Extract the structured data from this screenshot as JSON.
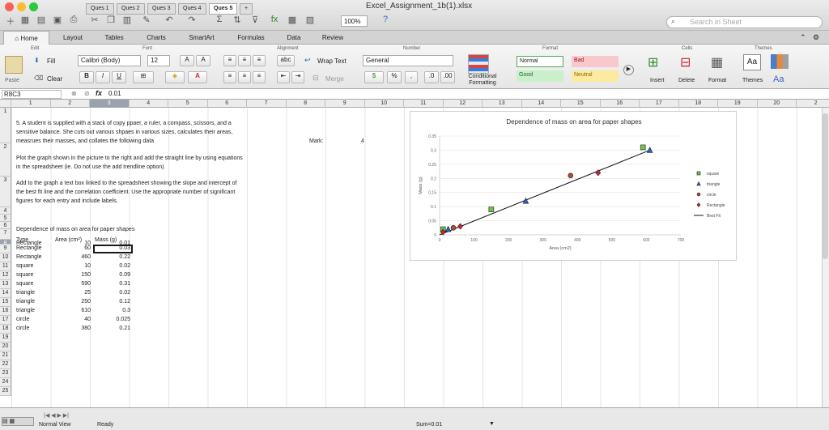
{
  "window": {
    "title": "Excel_Assignment_1b(1).xlsx",
    "zoom": "100%"
  },
  "search": {
    "placeholder": "Search in Sheet"
  },
  "ribbon_tabs": [
    "Home",
    "Layout",
    "Tables",
    "Charts",
    "SmartArt",
    "Formulas",
    "Data",
    "Review"
  ],
  "ribbon": {
    "groups": {
      "edit": "Edit",
      "font": "Font",
      "alignment": "Alignment",
      "number": "Number",
      "format": "Format",
      "cells": "Cells",
      "themes": "Themes"
    },
    "fill": "Fill",
    "clear": "Clear",
    "paste": "Paste",
    "font_name": "Calibri (Body)",
    "font_size": "12",
    "wrap_text": "Wrap Text",
    "merge": "Merge",
    "number_format": "General",
    "conditional_formatting": "Conditional Formatting",
    "styles": {
      "normal": "Normal",
      "bad": "Bad",
      "good": "Good",
      "neutral": "Neutral"
    },
    "insert": "Insert",
    "delete": "Delete",
    "format": "Format",
    "themes": "Themes",
    "bold": "B",
    "italic": "I",
    "underline": "U",
    "abc": "abc",
    "font_aa": "Aa"
  },
  "formula_bar": {
    "cell_ref": "R8C3",
    "fx": "fx",
    "value": "0.01"
  },
  "columns": [
    "1",
    "2",
    "3",
    "4",
    "5",
    "6",
    "7",
    "8",
    "9",
    "10",
    "11",
    "12",
    "13",
    "14",
    "15",
    "16",
    "17",
    "18",
    "19",
    "20",
    "2"
  ],
  "rows": [
    "1",
    "2",
    "3",
    "4",
    "5",
    "6",
    "7",
    "8",
    "9",
    "10",
    "11",
    "12",
    "13",
    "14",
    "15",
    "16",
    "17",
    "18",
    "19",
    "20",
    "21",
    "22",
    "23",
    "24",
    "25"
  ],
  "sheet": {
    "q5_text": [
      "5. A student is supplied with a stack of copy ppaer, a ruler, a compass, scissors, and a",
      "sensitive balance.  She cuts out various shpaes in various sizes, calculates their areas,",
      "measrues their masses, and collates the following data"
    ],
    "mark_label": "Mark:",
    "mark_value": "4",
    "plot_text": [
      "Plot the graph shown in the picture to the right and add the straight line by using equations",
      "in the spreadsheet (ie. Do not use the add trendline option)."
    ],
    "textbox_text": [
      "Add to the graph a text box linked to the spreadsheet showing the slope and intercept of",
      "the best fit line and the correlation coefficient.  Use the appropriate number of significant",
      "figures for each entry and include labels."
    ],
    "table_title": "Dependence of mass on area for paper shapes",
    "headers": {
      "type": "Type",
      "area": "Area (cm²)",
      "mass": "Mass (g)"
    },
    "table": [
      {
        "type": "Rectangle",
        "area": "10",
        "mass": "0.01"
      },
      {
        "type": "Rectangle",
        "area": "60",
        "mass": "0.03"
      },
      {
        "type": "Rectangle",
        "area": "460",
        "mass": "0.22"
      },
      {
        "type": "square",
        "area": "10",
        "mass": "0.02"
      },
      {
        "type": "square",
        "area": "150",
        "mass": "0.09"
      },
      {
        "type": "square",
        "area": "590",
        "mass": "0.31"
      },
      {
        "type": "triangle",
        "area": "25",
        "mass": "0.02"
      },
      {
        "type": "triangle",
        "area": "250",
        "mass": "0.12"
      },
      {
        "type": "triangle",
        "area": "610",
        "mass": "0.3"
      },
      {
        "type": "circle",
        "area": "40",
        "mass": "0.025"
      },
      {
        "type": "circle",
        "area": "380",
        "mass": "0.21"
      }
    ]
  },
  "chart_data": {
    "type": "scatter",
    "title": "Dependence of mass on area for paper shapes",
    "xlabel": "Area (cm2)",
    "ylabel": "Mass (g)",
    "xlim": [
      0,
      700
    ],
    "ylim": [
      0,
      0.35
    ],
    "xticks": [
      0,
      100,
      200,
      300,
      400,
      500,
      600,
      700
    ],
    "yticks": [
      0,
      0.05,
      0.1,
      0.15,
      0.2,
      0.25,
      0.3,
      0.35
    ],
    "ytick_labels": [
      "0",
      "0.05",
      "0.1",
      "0.15",
      "0.2",
      "0.25",
      "0.3",
      "0.35"
    ],
    "legend_position": "right",
    "series": [
      {
        "name": "square",
        "marker": "square",
        "color": "#6fc24a",
        "x": [
          10,
          150,
          590
        ],
        "y": [
          0.02,
          0.09,
          0.31
        ]
      },
      {
        "name": "triangle",
        "marker": "triangle",
        "color": "#2a62c6",
        "x": [
          25,
          250,
          610
        ],
        "y": [
          0.02,
          0.12,
          0.3
        ]
      },
      {
        "name": "circle",
        "marker": "circle",
        "color": "#b24a2e",
        "x": [
          40,
          380
        ],
        "y": [
          0.025,
          0.21
        ]
      },
      {
        "name": "Rectangle",
        "marker": "diamond",
        "color": "#d8222a",
        "x": [
          10,
          60,
          460
        ],
        "y": [
          0.01,
          0.03,
          0.22
        ]
      }
    ],
    "best_fit": {
      "name": "Best Fit",
      "x": [
        0,
        610
      ],
      "y": [
        0.0,
        0.3
      ]
    }
  },
  "sheet_tabs": [
    "Ques 1",
    "Ques 2",
    "Ques 3",
    "Ques 4",
    "Ques 5",
    "+"
  ],
  "active_tab": "Ques 5",
  "status": {
    "view": "Normal View",
    "ready": "Ready",
    "sum": "Sum=0.01"
  }
}
